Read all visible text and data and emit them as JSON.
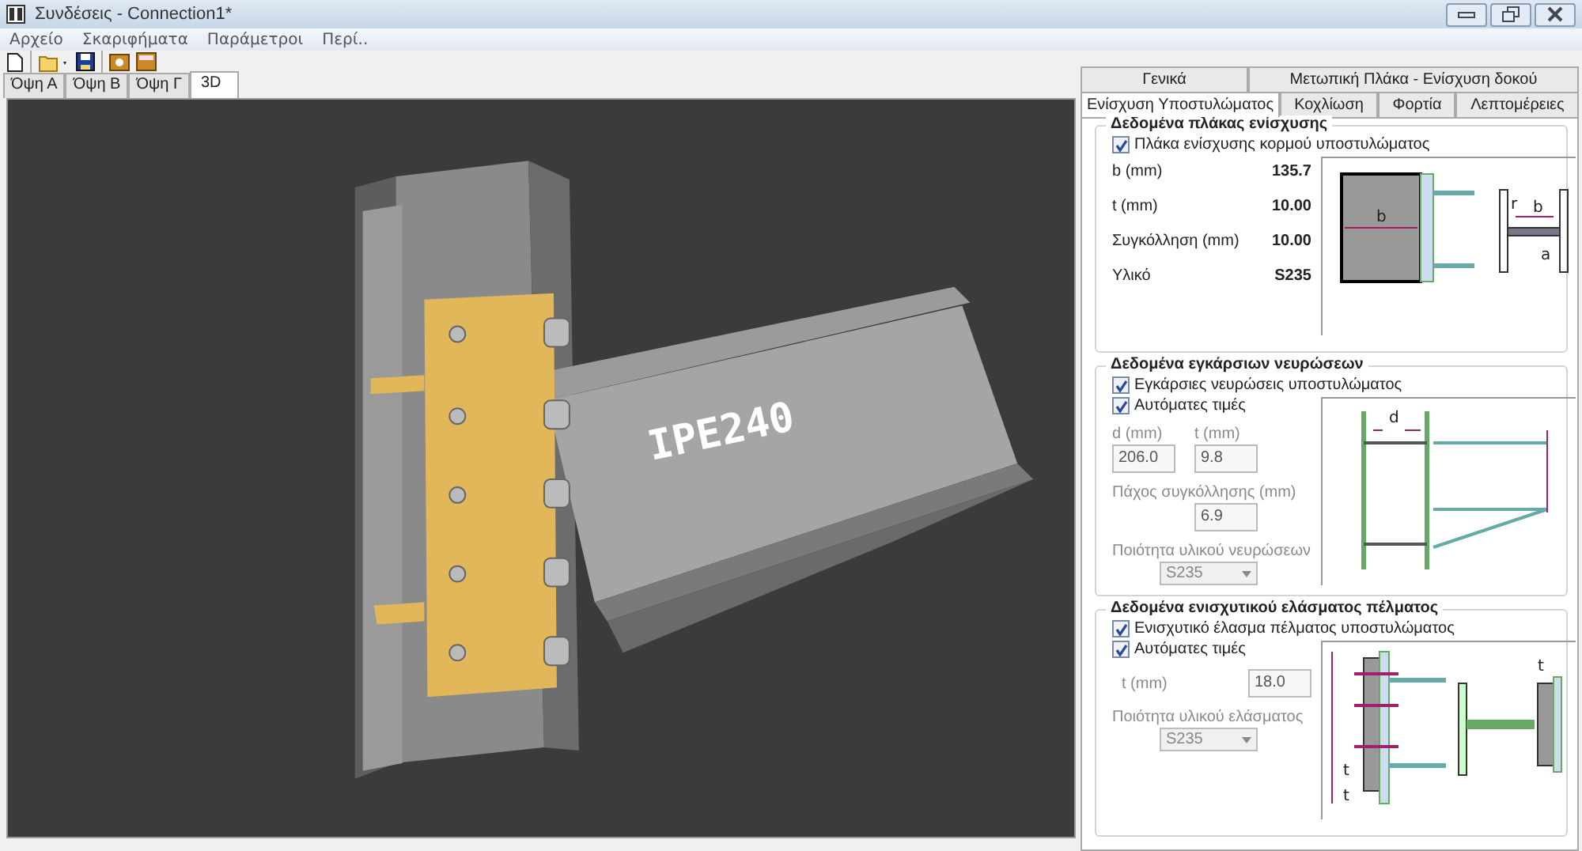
{
  "window": {
    "title": "Συνδέσεις - Connection1*"
  },
  "menu": [
    {
      "label": "Αρχείο"
    },
    {
      "label": "Σκαριφήματα"
    },
    {
      "label": "Παράμετροι"
    },
    {
      "label": "Περί.."
    }
  ],
  "view_tabs": [
    {
      "label": "Όψη Α",
      "selected": false
    },
    {
      "label": "Όψη Β",
      "selected": false
    },
    {
      "label": "Όψη Γ",
      "selected": false
    },
    {
      "label": "3D",
      "selected": true
    }
  ],
  "viewport": {
    "beam_label": "IPE240"
  },
  "panel_tabs": [
    [
      {
        "label": "Γενικά",
        "selected": false
      },
      {
        "label": "Μετωπική Πλάκα - Ενίσχυση δοκού",
        "selected": false
      }
    ],
    [
      {
        "label": "Ενίσχυση Υποστυλώματος",
        "selected": true
      },
      {
        "label": "Κοχλίωση",
        "selected": false
      },
      {
        "label": "Φορτία",
        "selected": false
      },
      {
        "label": "Λεπτομέρειες",
        "selected": false
      }
    ]
  ],
  "groups": [
    {
      "title": "Δεδομένα πλάκας ενίσχυσης",
      "top": [
        {
          "kind": "checkbox",
          "label": "Πλάκα ενίσχυσης κορμού υποστυλώματος",
          "checked": true
        }
      ],
      "rows": [
        {
          "kind": "value",
          "label": "b (mm)",
          "value": "135.7"
        },
        {
          "kind": "value",
          "label": "t (mm)",
          "value": "10.00"
        },
        {
          "kind": "value",
          "label": "Συγκόλληση (mm)",
          "value": "10.00"
        },
        {
          "kind": "value",
          "label": "Υλικό",
          "value": "S235"
        }
      ],
      "diagram": {
        "kind": "plate",
        "labels": [
          "b",
          "r",
          "b",
          "a"
        ]
      }
    },
    {
      "title": "Δεδομένα εγκάρσιων νευρώσεων",
      "top": [
        {
          "kind": "checkbox",
          "label": "Εγκάρσιες νευρώσεις υποστυλώματος",
          "checked": true
        }
      ],
      "rows": [
        {
          "kind": "checkbox",
          "label": "Αυτόματες τιμές",
          "checked": true
        },
        {
          "kind": "pair",
          "fields": [
            {
              "label": "d (mm)",
              "value": "206.0",
              "disabled": true
            },
            {
              "label": "t (mm)",
              "value": "9.8",
              "disabled": true
            }
          ]
        },
        {
          "kind": "input",
          "label": "Πάχος συγκόλλησης (mm)",
          "value": "6.9",
          "disabled": true
        },
        {
          "kind": "select",
          "label": "Ποιότητα υλικού νευρώσεων",
          "value": "S235",
          "disabled": true
        }
      ],
      "diagram": {
        "kind": "stiffener",
        "labels": [
          "d"
        ]
      }
    },
    {
      "title": "Δεδομένα ενισχυτικού ελάσματος πέλματος",
      "top": [
        {
          "kind": "checkbox",
          "label": "Ενισχυτικό έλασμα πέλματος υποστυλώματος",
          "checked": true
        }
      ],
      "rows": [
        {
          "kind": "checkbox",
          "label": "Αυτόματες τιμές",
          "checked": true
        },
        {
          "kind": "inline",
          "label": "t (mm)",
          "value": "18.0",
          "disabled": true
        },
        {
          "kind": "select",
          "label": "Ποιότητα υλικού ελάσματος",
          "value": "S235",
          "disabled": true
        }
      ],
      "diagram": {
        "kind": "flange",
        "labels": [
          "t",
          "t",
          "t"
        ]
      }
    }
  ]
}
